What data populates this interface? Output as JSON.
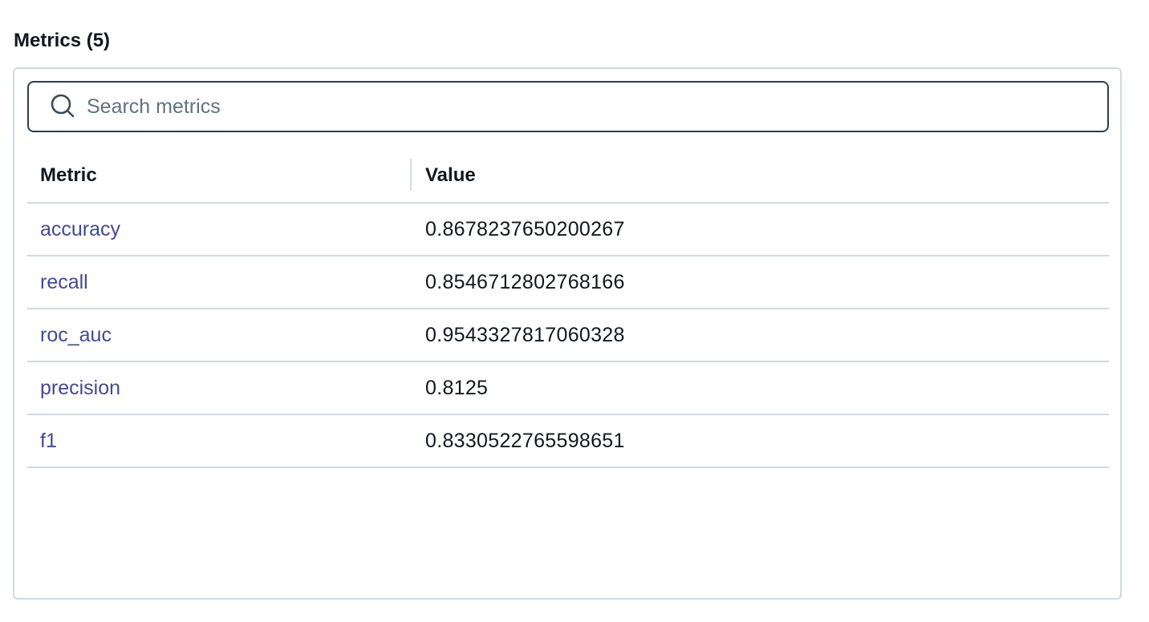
{
  "section": {
    "title": "Metrics (5)"
  },
  "search": {
    "icon": "search-icon",
    "placeholder": "Search metrics",
    "value": ""
  },
  "table": {
    "columns": [
      "Metric",
      "Value"
    ],
    "rows": [
      {
        "metric": "accuracy",
        "value": "0.8678237650200267"
      },
      {
        "metric": "recall",
        "value": "0.8546712802768166"
      },
      {
        "metric": "roc_auc",
        "value": "0.9543327817060328"
      },
      {
        "metric": "precision",
        "value": "0.8125"
      },
      {
        "metric": "f1",
        "value": "0.8330522765598651"
      }
    ]
  },
  "colors": {
    "link": "#434a93",
    "border": "#d1d9e1",
    "search_border": "#2e3a59",
    "text": "#11171c",
    "placeholder": "#5f7281"
  }
}
